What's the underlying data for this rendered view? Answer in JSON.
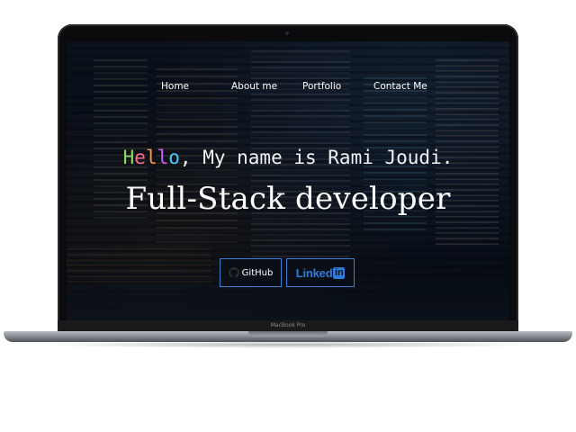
{
  "nav": {
    "items": [
      {
        "label": "Home"
      },
      {
        "label": "About me"
      },
      {
        "label": "Portfolio"
      },
      {
        "label": "Contact Me"
      }
    ]
  },
  "hero": {
    "greeting_letters": [
      "H",
      "e",
      "l",
      "l",
      "o"
    ],
    "greeting_rest": ", My name is Rami Joudi.",
    "role": "Full-Stack developer"
  },
  "buttons": {
    "github_label": "GitHub",
    "linkedin_word": "Linked",
    "linkedin_box": "in"
  },
  "device": {
    "model_label": "MacBook Pro"
  },
  "colors": {
    "accent_border": "#3f7fd6",
    "linkedin_blue": "#2f7bd8",
    "greeting_letter_colors": [
      "#8fdc62",
      "#ff6b8e",
      "#ff9a4a",
      "#d25fff",
      "#4cc9ff"
    ]
  },
  "icons": {
    "github": "github-octocat-icon"
  }
}
